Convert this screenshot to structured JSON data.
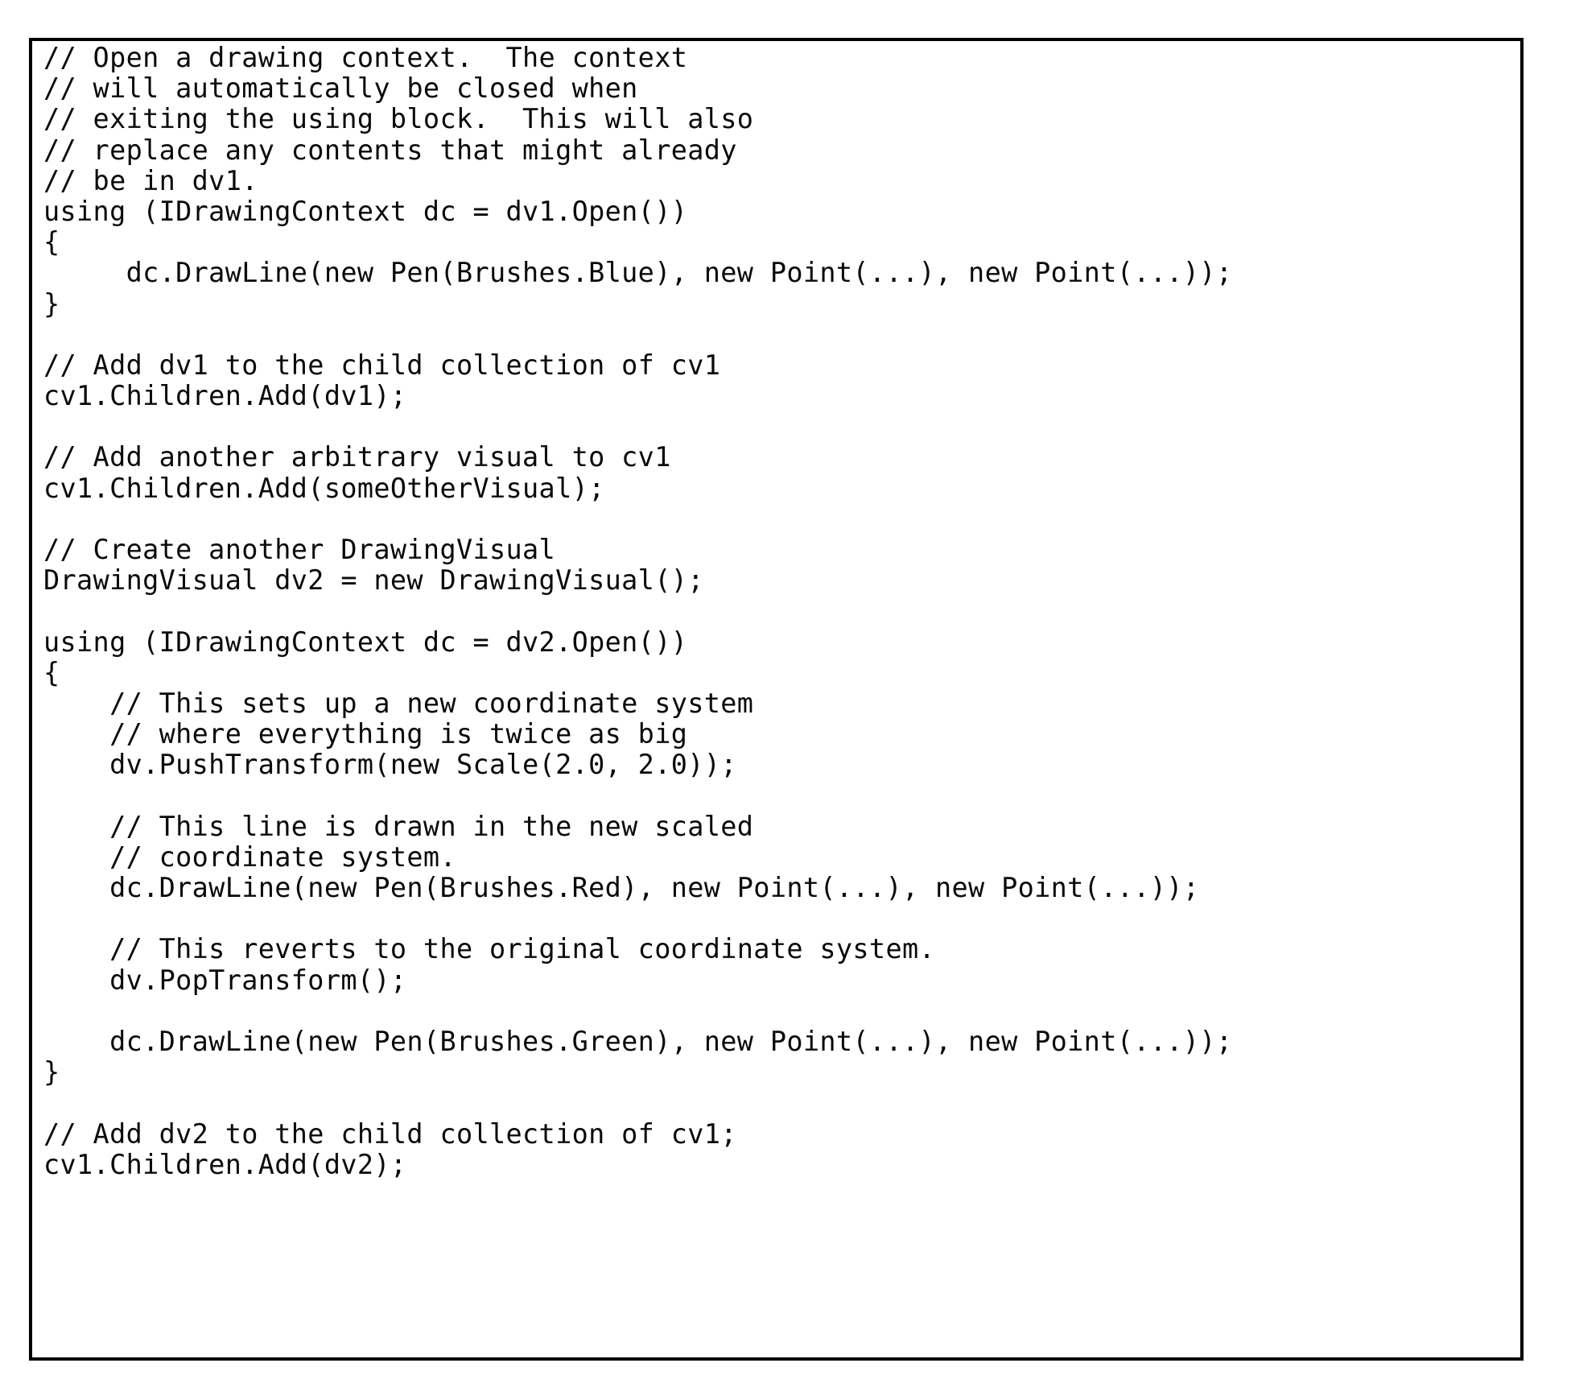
{
  "document": {
    "kind": "code-listing",
    "language": "C#",
    "border_color": "#000000",
    "text_color": "#000000",
    "background_color": "#ffffff"
  },
  "code": {
    "lines": [
      "// Open a drawing context.  The context",
      "// will automatically be closed when",
      "// exiting the using block.  This will also",
      "// replace any contents that might already",
      "// be in dv1.",
      "using (IDrawingContext dc = dv1.Open())",
      "{",
      "     dc.DrawLine(new Pen(Brushes.Blue), new Point(...), new Point(...));",
      "}",
      "",
      "// Add dv1 to the child collection of cv1",
      "cv1.Children.Add(dv1);",
      "",
      "// Add another arbitrary visual to cv1",
      "cv1.Children.Add(someOtherVisual);",
      "",
      "// Create another DrawingVisual",
      "DrawingVisual dv2 = new DrawingVisual();",
      "",
      "using (IDrawingContext dc = dv2.Open())",
      "{",
      "    // This sets up a new coordinate system",
      "    // where everything is twice as big",
      "    dv.PushTransform(new Scale(2.0, 2.0));",
      "",
      "    // This line is drawn in the new scaled",
      "    // coordinate system.",
      "    dc.DrawLine(new Pen(Brushes.Red), new Point(...), new Point(...));",
      "",
      "    // This reverts to the original coordinate system.",
      "    dv.PopTransform();",
      "",
      "    dc.DrawLine(new Pen(Brushes.Green), new Point(...), new Point(...));",
      "}",
      "",
      "// Add dv2 to the child collection of cv1;",
      "cv1.Children.Add(dv2);"
    ]
  }
}
